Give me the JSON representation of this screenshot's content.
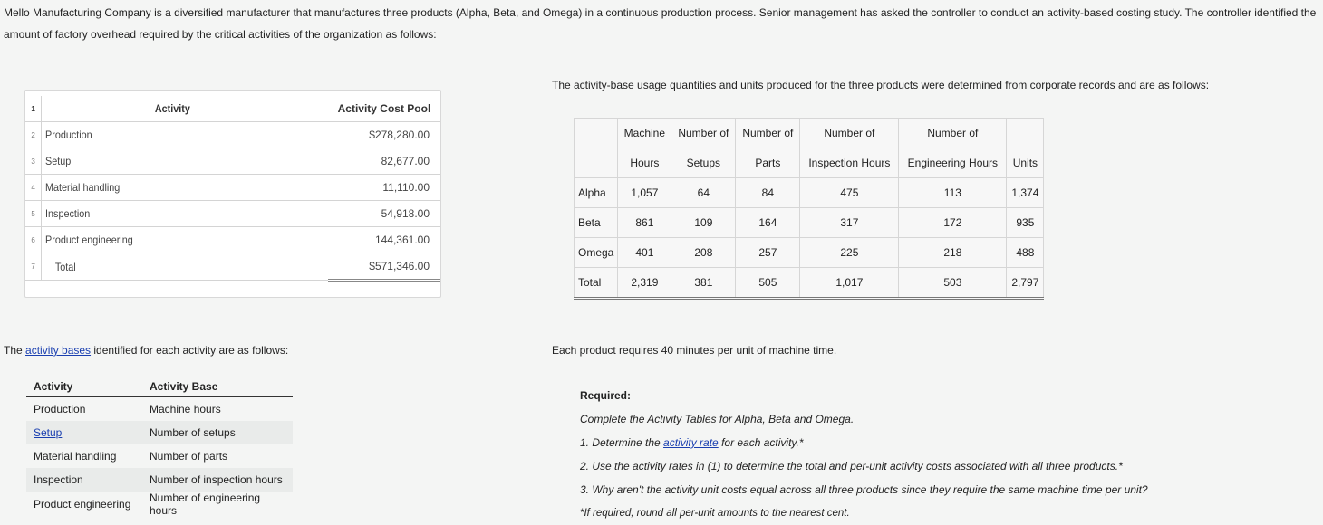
{
  "intro": "Mello Manufacturing Company is a diversified manufacturer that manufactures three products (Alpha, Beta, and Omega) in a continuous production process. Senior management has asked the controller to conduct an activity-based costing study. The controller identified the amount of factory overhead required by the critical activities of the organization as follows:",
  "cost_table": {
    "header": {
      "row": "1",
      "activity": "Activity",
      "cost": "Activity Cost Pool"
    },
    "rows": [
      {
        "row": "2",
        "activity": "Production",
        "cost": "$278,280.00"
      },
      {
        "row": "3",
        "activity": "Setup",
        "cost": "82,677.00"
      },
      {
        "row": "4",
        "activity": "Material handling",
        "cost": "11,110.00"
      },
      {
        "row": "5",
        "activity": "Inspection",
        "cost": "54,918.00"
      },
      {
        "row": "6",
        "activity": "Product engineering",
        "cost": "144,361.00"
      },
      {
        "row": "7",
        "activity": "Total",
        "cost": "$571,346.00"
      }
    ]
  },
  "usage_caption": "The activity-base usage quantities and units produced for the three products were determined from corporate records and are as follows:",
  "usage_table": {
    "header1": [
      "",
      "Machine",
      "Number of",
      "Number of",
      "Number of",
      "Number of",
      ""
    ],
    "header2": [
      "",
      "Hours",
      "Setups",
      "Parts",
      "Inspection Hours",
      "Engineering Hours",
      "Units"
    ],
    "rows": [
      [
        "Alpha",
        "1,057",
        "64",
        "84",
        "475",
        "113",
        "1,374"
      ],
      [
        "Beta",
        "861",
        "109",
        "164",
        "317",
        "172",
        "935"
      ],
      [
        "Omega",
        "401",
        "208",
        "257",
        "225",
        "218",
        "488"
      ],
      [
        "Total",
        "2,319",
        "381",
        "505",
        "1,017",
        "503",
        "2,797"
      ]
    ]
  },
  "bases_caption": {
    "prefix": "The ",
    "link": "activity bases",
    "suffix": " identified for each activity are as follows:"
  },
  "bases_table": {
    "headers": [
      "Activity",
      "Activity Base"
    ],
    "rows": [
      {
        "activity": "Production",
        "base": "Machine hours"
      },
      {
        "activity": "Setup",
        "base": "Number of setups"
      },
      {
        "activity": "Material handling",
        "base": "Number of parts"
      },
      {
        "activity": "Inspection",
        "base": "Number of inspection hours"
      },
      {
        "activity": "Product engineering",
        "base": "Number of engineering hours"
      }
    ]
  },
  "machine_note": "Each product requires 40 minutes per unit of machine time.",
  "required": {
    "title": "Required:",
    "line0": "Complete the Activity Tables for Alpha, Beta and Omega.",
    "line1_prefix": "1.  Determine the ",
    "line1_link": "activity rate",
    "line1_suffix": " for each activity.*",
    "line2": "2.  Use the activity rates in (1) to determine the total and per-unit activity costs associated with all three products.*",
    "line3": "3.  Why aren't the activity unit costs equal across all three products since they require the same machine time per unit?",
    "note": "*If required, round all per-unit amounts to the nearest cent."
  }
}
